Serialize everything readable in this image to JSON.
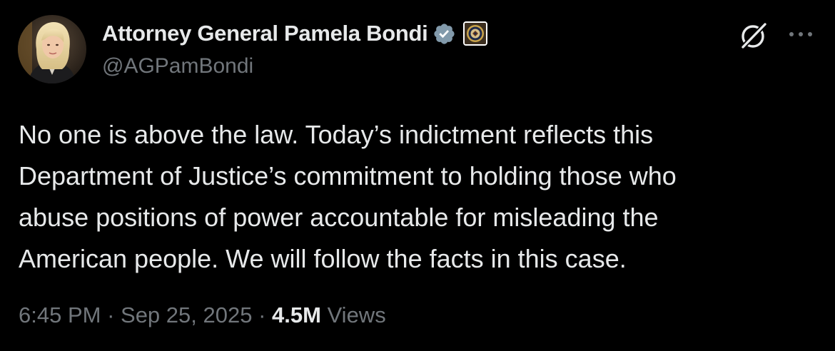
{
  "author": {
    "display_name": "Attorney General Pamela Bondi",
    "handle": "@AGPamBondi",
    "verified_badge_color": "#829aab"
  },
  "tweet": {
    "lines": [
      "No one is above the law. Today’s indictment reflects this",
      "Department of Justice’s commitment to holding those who",
      "abuse positions of power accountable for misleading the",
      "American people. We will follow the facts in this case."
    ]
  },
  "meta": {
    "time": "6:45 PM",
    "separator": "·",
    "date": "Sep 25, 2025",
    "views_count": "4.5M",
    "views_label": "Views"
  },
  "icons": {
    "verified": "verified-badge-icon",
    "affiliation": "doj-seal-icon",
    "grok": "grok-icon",
    "more": "more-icon"
  },
  "colors": {
    "background": "#000000",
    "text": "#e7e9ea",
    "secondary": "#71767b"
  }
}
